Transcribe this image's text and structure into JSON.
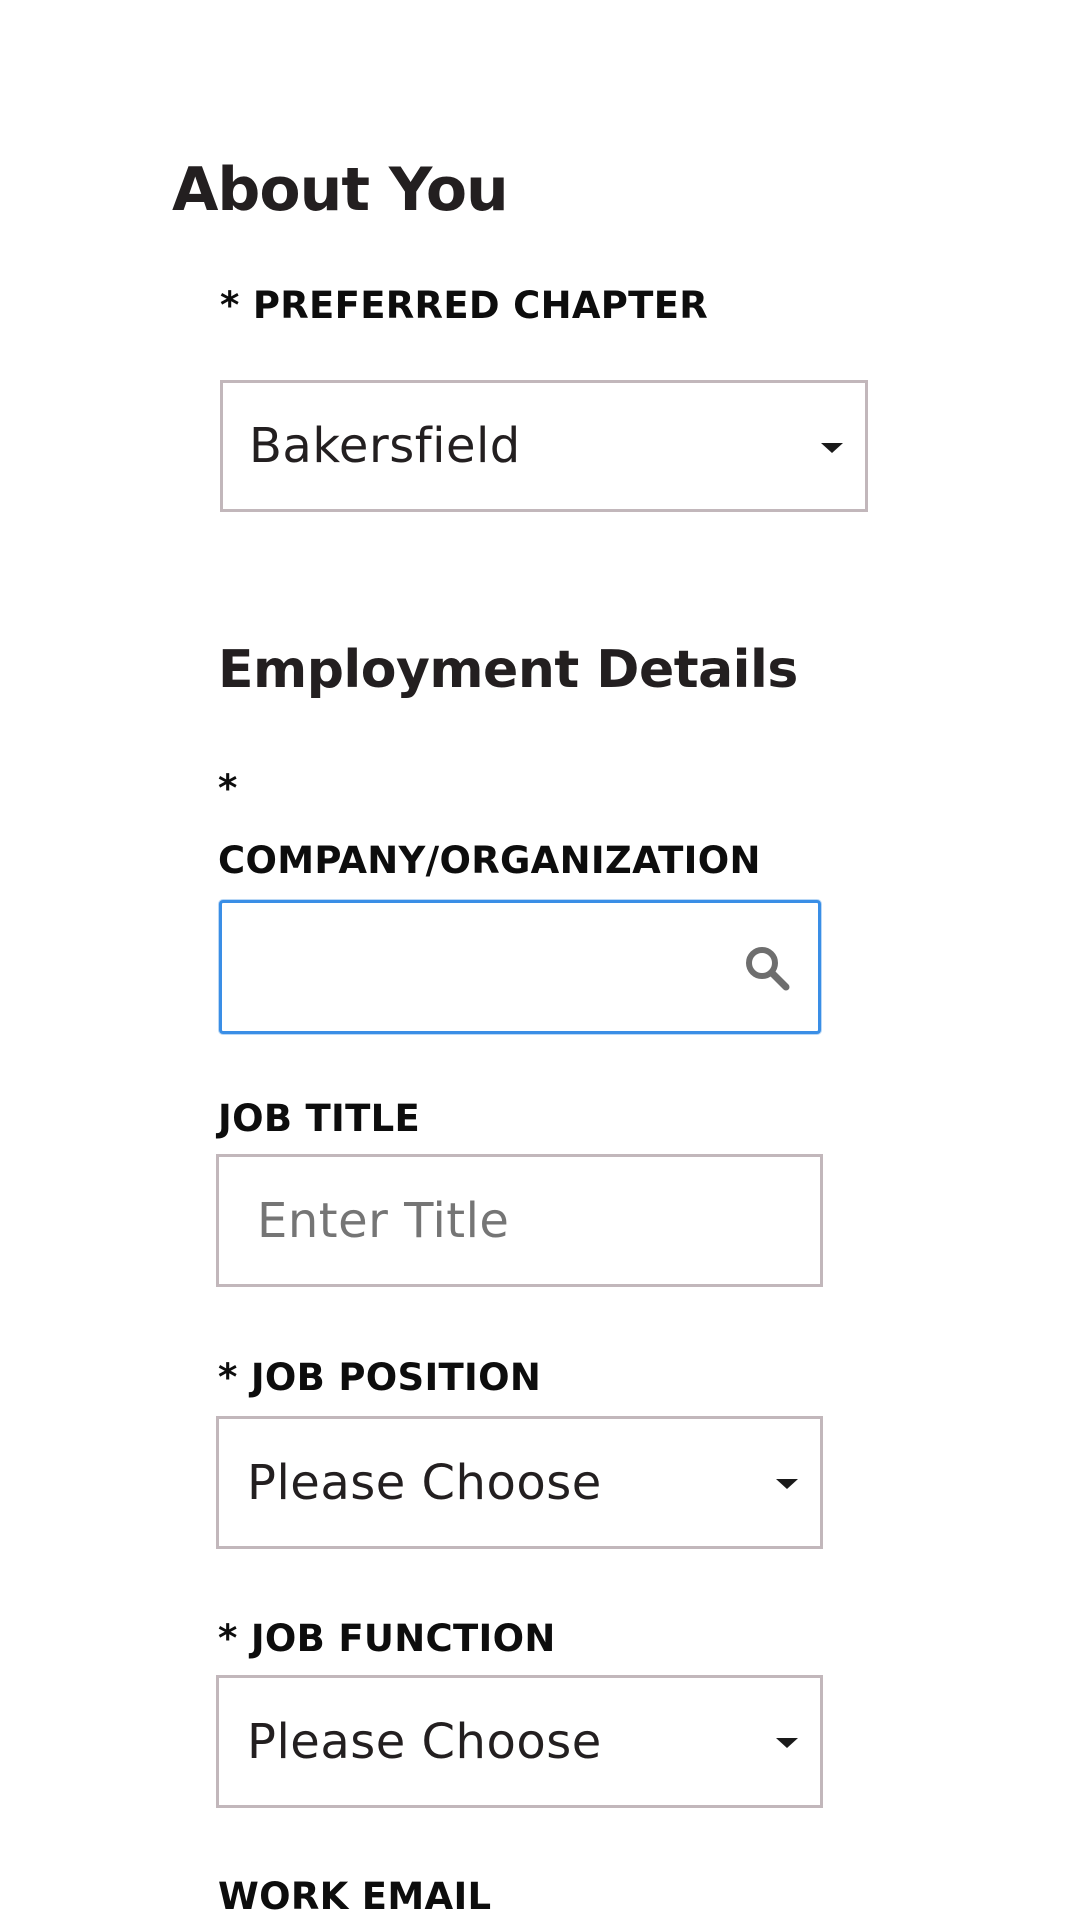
{
  "about": {
    "heading": "About You",
    "preferred_chapter": {
      "label": "* PREFERRED CHAPTER",
      "value": "Bakersfield",
      "icon": "chevron-down-icon"
    }
  },
  "employment": {
    "heading": "Employment Details",
    "company": {
      "required_mark": "*",
      "label": "COMPANY/ORGANIZATION",
      "value": "",
      "placeholder": "",
      "icon": "search-icon"
    },
    "job_title": {
      "label": "JOB TITLE",
      "value": "",
      "placeholder": "Enter Title"
    },
    "job_position": {
      "label": "* JOB POSITION",
      "value": "Please Choose",
      "icon": "chevron-down-icon"
    },
    "job_function": {
      "label": "* JOB FUNCTION",
      "value": "Please Choose",
      "icon": "chevron-down-icon"
    },
    "work_email": {
      "label": "WORK EMAIL"
    }
  },
  "colors": {
    "text": "#231f20",
    "field_border": "#c2b7bb",
    "focus_border": "#3a8ee6",
    "placeholder": "#6b6b6b"
  }
}
